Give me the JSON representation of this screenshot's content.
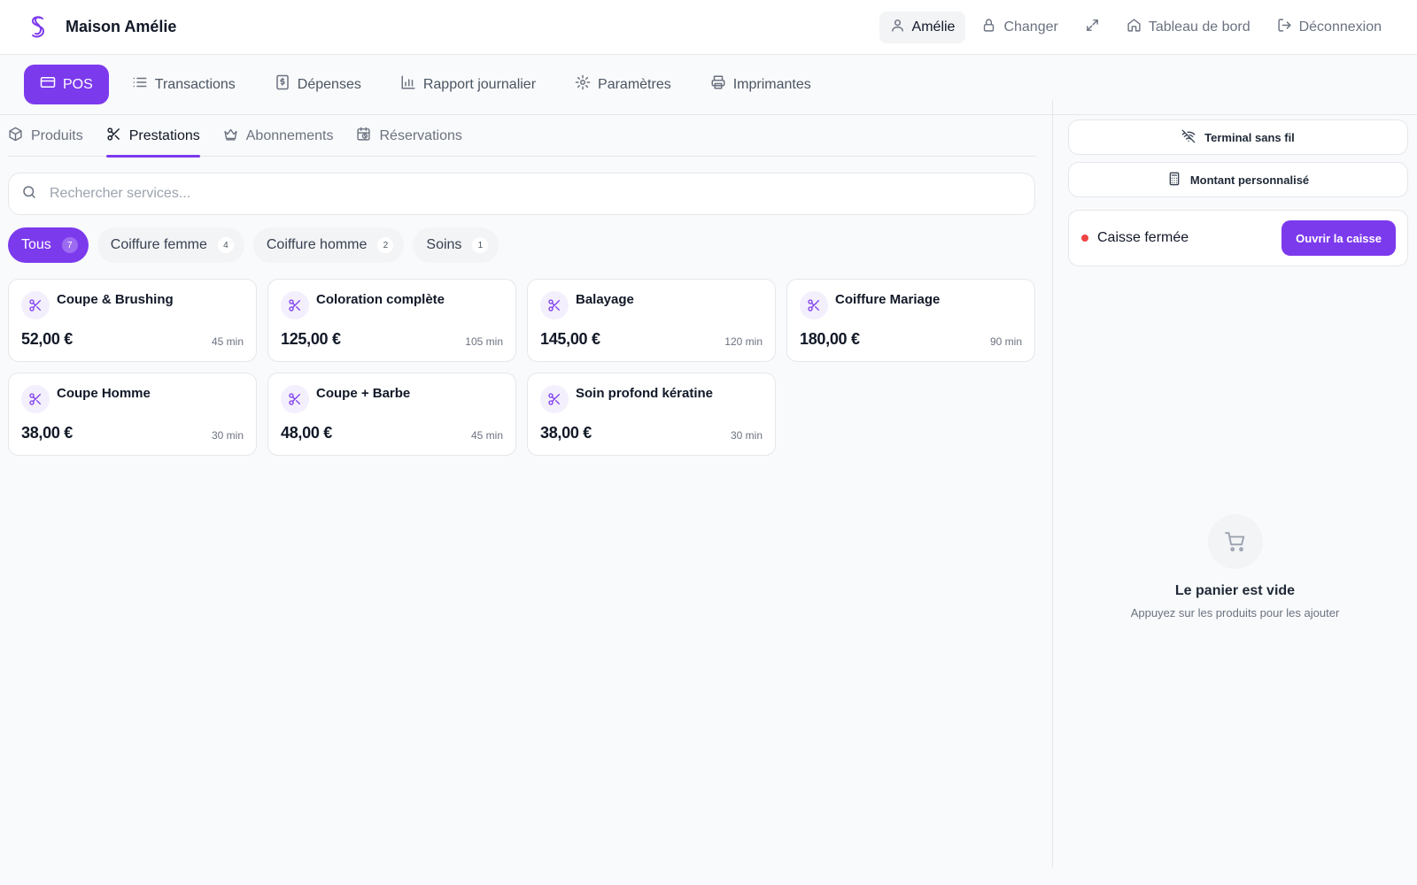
{
  "brand": {
    "name": "Maison Amélie",
    "logo_icon": "s-logo-icon",
    "accent_color": "#7c3aed"
  },
  "topbar": {
    "user_label": "Amélie",
    "switch_label": "Changer",
    "dashboard_label": "Tableau de bord",
    "logout_label": "Déconnexion"
  },
  "nav": {
    "items": [
      {
        "label": "POS",
        "icon": "card-icon",
        "active": true
      },
      {
        "label": "Transactions",
        "icon": "list-icon"
      },
      {
        "label": "Dépenses",
        "icon": "receipt-icon"
      },
      {
        "label": "Rapport journalier",
        "icon": "bar-chart-icon"
      },
      {
        "label": "Paramètres",
        "icon": "gear-icon"
      },
      {
        "label": "Imprimantes",
        "icon": "printer-icon"
      }
    ]
  },
  "subtabs": {
    "items": [
      {
        "label": "Produits",
        "icon": "box-icon"
      },
      {
        "label": "Prestations",
        "icon": "scissors-icon",
        "active": true
      },
      {
        "label": "Abonnements",
        "icon": "crown-icon"
      },
      {
        "label": "Réservations",
        "icon": "calendar-clock-icon"
      }
    ]
  },
  "search": {
    "placeholder": "Rechercher services...",
    "value": ""
  },
  "filters": {
    "items": [
      {
        "label": "Tous",
        "count": "7",
        "active": true
      },
      {
        "label": "Coiffure femme",
        "count": "4"
      },
      {
        "label": "Coiffure homme",
        "count": "2"
      },
      {
        "label": "Soins",
        "count": "1"
      }
    ]
  },
  "services": {
    "items": [
      {
        "name": "Coupe & Brushing",
        "price": "52,00 €",
        "duration": "45 min"
      },
      {
        "name": "Coloration complète",
        "price": "125,00 €",
        "duration": "105 min"
      },
      {
        "name": "Balayage",
        "price": "145,00 €",
        "duration": "120 min"
      },
      {
        "name": "Coiffure Mariage",
        "price": "180,00 €",
        "duration": "90 min"
      },
      {
        "name": "Coupe Homme",
        "price": "38,00 €",
        "duration": "30 min"
      },
      {
        "name": "Coupe + Barbe",
        "price": "48,00 €",
        "duration": "45 min"
      },
      {
        "name": "Soin profond kératine",
        "price": "38,00 €",
        "duration": "30 min"
      }
    ]
  },
  "right_panel": {
    "wireless_terminal_label": "Terminal sans fil",
    "custom_amount_label": "Montant personnalisé",
    "register_status": "Caisse fermée",
    "register_status_color": "#ef4444",
    "open_register_label": "Ouvrir la caisse",
    "cart": {
      "empty_title": "Le panier est vide",
      "empty_subtitle": "Appuyez sur les produits pour les ajouter"
    }
  }
}
